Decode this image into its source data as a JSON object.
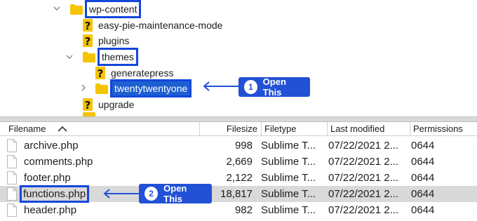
{
  "tree": {
    "wp_content": "wp-content",
    "easy_pie": "easy-pie-maintenance-mode",
    "plugins": "plugins",
    "themes": "themes",
    "generatepress": "generatepress",
    "twentytwentyone": "twentytwentyone",
    "upgrade": "upgrade"
  },
  "callouts": {
    "one": {
      "num": "1",
      "label": "Open This"
    },
    "two": {
      "num": "2",
      "label": "Open This"
    }
  },
  "table": {
    "columns": {
      "filename": "Filename",
      "filesize": "Filesize",
      "filetype": "Filetype",
      "last_modified": "Last modified",
      "permissions": "Permissions"
    },
    "rows": [
      {
        "name": "archive.php",
        "size": "998",
        "type": "Sublime T...",
        "modified": "07/22/2021 2...",
        "perm": "0644"
      },
      {
        "name": "comments.php",
        "size": "2,669",
        "type": "Sublime T...",
        "modified": "07/22/2021 2...",
        "perm": "0644"
      },
      {
        "name": "footer.php",
        "size": "2,122",
        "type": "Sublime T...",
        "modified": "07/22/2021 2...",
        "perm": "0644"
      },
      {
        "name": "functions.php",
        "size": "18,817",
        "type": "Sublime T...",
        "modified": "07/22/2021 2...",
        "perm": "0644"
      },
      {
        "name": "header.php",
        "size": "982",
        "type": "Sublime T...",
        "modified": "07/22/2021 2...",
        "perm": "0644"
      }
    ]
  },
  "colors": {
    "highlight_box": "#1446d9",
    "selection": "#1d5fd1",
    "callout": "#2251d6",
    "folder": "#f5c400",
    "row_selected": "#d9d9d9"
  },
  "icons": {
    "folder": "folder-icon",
    "unknown": "question-mark-icon",
    "file": "file-icon",
    "sort": "sort-ascending-icon",
    "chevron_down": "chevron-down-icon",
    "chevron_right": "chevron-right-icon"
  }
}
